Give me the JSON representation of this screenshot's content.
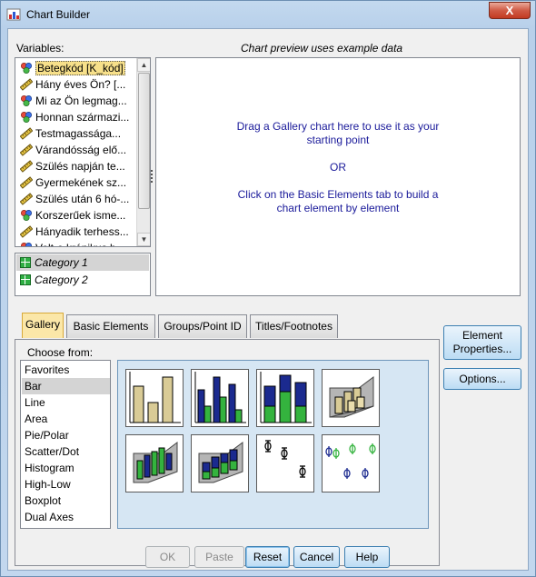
{
  "window": {
    "title": "Chart Builder",
    "close_label": "X"
  },
  "variables": {
    "label": "Variables:",
    "items": [
      {
        "label": "Betegkód [K_kód]",
        "icon": "nominal-icon",
        "selected": true
      },
      {
        "label": "Hány éves Ön? [...",
        "icon": "scale-icon"
      },
      {
        "label": "Mi az Ön legmag...",
        "icon": "nominal-icon"
      },
      {
        "label": "Honnan származi...",
        "icon": "nominal-icon"
      },
      {
        "label": "Testmagassága...",
        "icon": "scale-icon"
      },
      {
        "label": "Várandósság elő...",
        "icon": "scale-icon"
      },
      {
        "label": "Szülés napján te...",
        "icon": "scale-icon"
      },
      {
        "label": "Gyermekének sz...",
        "icon": "scale-icon"
      },
      {
        "label": "Szülés után 6 hó-...",
        "icon": "scale-icon"
      },
      {
        "label": "Korszerűek isme...",
        "icon": "nominal-icon"
      },
      {
        "label": "Hányadik terhess...",
        "icon": "scale-icon"
      },
      {
        "label": "Volt-e krónikus b...",
        "icon": "nominal-icon"
      }
    ]
  },
  "categories": [
    {
      "label": "Category 1",
      "active": true
    },
    {
      "label": "Category 2",
      "active": false
    }
  ],
  "preview": {
    "header": "Chart preview uses example data",
    "line1": "Drag a Gallery chart here to use it as your",
    "line2": "starting point",
    "or": "OR",
    "line3": "Click on the Basic Elements tab to build a",
    "line4": "chart element by element"
  },
  "tabs": [
    {
      "label": "Gallery",
      "active": true
    },
    {
      "label": "Basic Elements"
    },
    {
      "label": "Groups/Point ID"
    },
    {
      "label": "Titles/Footnotes"
    }
  ],
  "gallery": {
    "choose_label": "Choose from:",
    "types": [
      "Favorites",
      "Bar",
      "Line",
      "Area",
      "Pie/Polar",
      "Scatter/Dot",
      "Histogram",
      "High-Low",
      "Boxplot",
      "Dual Axes"
    ],
    "selected_type": "Bar",
    "thumbnails": [
      "simple-bar-icon",
      "clustered-bar-icon",
      "stacked-bar-icon",
      "simple-3d-bar-icon",
      "clustered-3d-bar-icon",
      "stacked-3d-bar-icon",
      "simple-error-bar-icon",
      "clustered-error-bar-icon"
    ]
  },
  "side_buttons": {
    "element_properties_line1": "Element",
    "element_properties_line2": "Properties...",
    "options": "Options..."
  },
  "bottom_buttons": {
    "ok": "OK",
    "paste": "Paste",
    "reset": "Reset",
    "cancel": "Cancel",
    "help": "Help"
  },
  "colors": {
    "bar_tan": "#d9cb96",
    "bar_navy": "#1b2a8f",
    "bar_green": "#34b33e",
    "tab_active": "#fbe7a8"
  }
}
